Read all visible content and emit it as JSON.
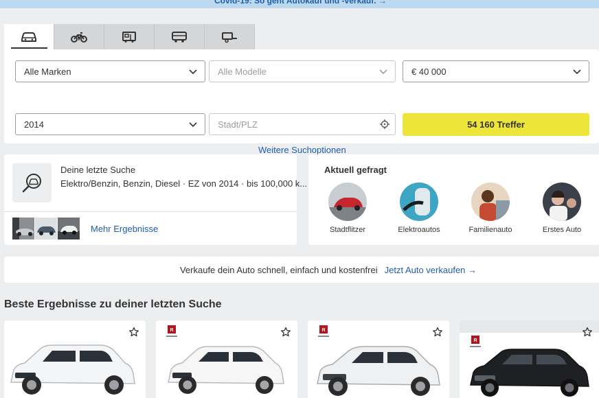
{
  "banner": {
    "text": "Covid-19: So geht Autokauf und -verkauf. →"
  },
  "vehicle_tabs": [
    {
      "icon": "car-icon",
      "active": true
    },
    {
      "icon": "motorcycle-icon",
      "active": false
    },
    {
      "icon": "motorhome-icon",
      "active": false
    },
    {
      "icon": "truck-icon",
      "active": false
    },
    {
      "icon": "trailer-icon",
      "active": false
    }
  ],
  "search": {
    "make": "Alle Marken",
    "model_placeholder": "Alle Modelle",
    "price": "€ 40 000",
    "year": "2014",
    "location_placeholder": "Stadt/PLZ",
    "results_button": "54 160 Treffer",
    "more_options": "Weitere Suchoptionen"
  },
  "last_search": {
    "title": "Deine letzte Suche",
    "description": "Elektro/Benzin, Benzin, Diesel · EZ von 2014 · bis 100,000 k...",
    "more_results": "Mehr Ergebnisse"
  },
  "trending": {
    "title": "Aktuell gefragt",
    "items": [
      {
        "label": "Stadtflitzer"
      },
      {
        "label": "Elektroautos"
      },
      {
        "label": "Familienauto"
      },
      {
        "label": "Erstes Auto"
      }
    ]
  },
  "sell": {
    "text": "Verkaufe dein Auto schnell, einfach und kostenfrei",
    "link": "Jetzt Auto verkaufen →"
  },
  "results_section": {
    "title": "Beste Ergebnisse zu deiner letzten Suche"
  },
  "colors": {
    "accent_yellow": "#eee53b",
    "link_blue": "#1f5ea8",
    "banner_bg": "#bcd9ef"
  }
}
